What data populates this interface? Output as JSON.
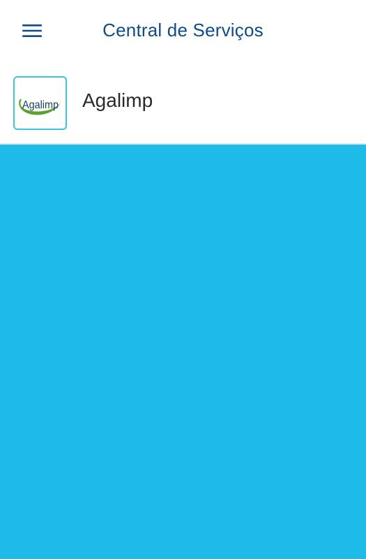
{
  "header": {
    "title": "Central de Serviços",
    "menu_icon": "hamburger-menu-icon"
  },
  "company": {
    "name": "Agalimp",
    "logo_text": "Agalimp"
  },
  "colors": {
    "brand_blue": "#0d4c8c",
    "content_background": "#1ebbe8",
    "logo_border": "#3cc3e6",
    "logo_green": "#5aa32a",
    "logo_text": "#16406e"
  }
}
